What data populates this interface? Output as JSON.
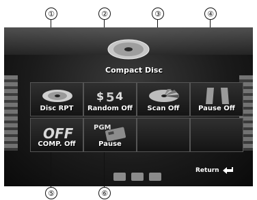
{
  "callouts": [
    "①",
    "②",
    "③",
    "④",
    "⑤",
    "⑥"
  ],
  "source": {
    "label": "Compact Disc",
    "icon": "compact-disc-icon"
  },
  "functions": [
    {
      "label": "Disc RPT",
      "icon": "disc-repeat-icon"
    },
    {
      "label": "Random Off",
      "icon": "random-icon"
    },
    {
      "label": "Scan Off",
      "icon": "scan-icon"
    },
    {
      "label": "Pause Off",
      "icon": "pause-icon"
    },
    {
      "label": "COMP. Off",
      "icon": "comp-icon"
    },
    {
      "label": "Pause",
      "icon": "pgm-pause-icon"
    }
  ],
  "return_label": "Return",
  "colors": {
    "screen_bg": "#1b1b1b",
    "text": "#ffffff",
    "tile_border": "#555555"
  }
}
